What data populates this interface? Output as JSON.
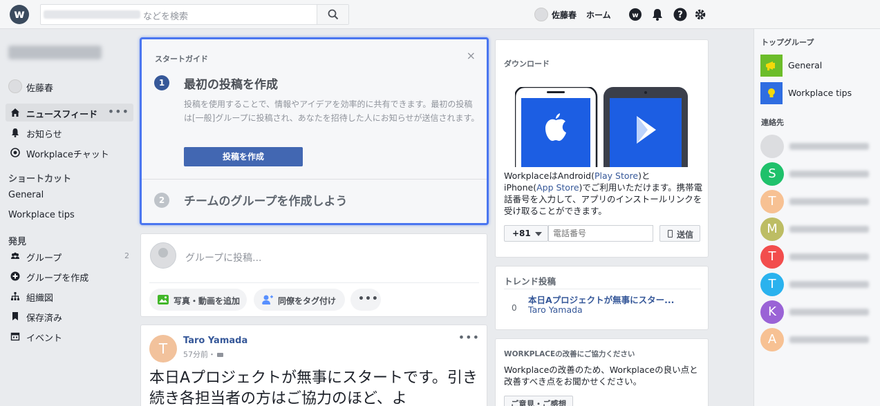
{
  "search": {
    "placeholder": "Delighted Inc.のグループなどを検索",
    "visible_suffix": "などを検索"
  },
  "topbar": {
    "logo_letter": "w",
    "user_name": "佐藤春",
    "home_label": "ホーム"
  },
  "leftnav": {
    "user_name": "佐藤春",
    "items": [
      {
        "label": "ニュースフィード",
        "more": "•••"
      },
      {
        "label": "お知らせ"
      },
      {
        "label": "Workplaceチャット"
      }
    ],
    "shortcuts_heading": "ショートカット",
    "shortcuts": [
      "General",
      "Workplace tips"
    ],
    "discover_heading": "発見",
    "discover": [
      {
        "label": "グループ",
        "count": "2"
      },
      {
        "label": "グループを作成"
      },
      {
        "label": "組織図"
      },
      {
        "label": "保存済み"
      },
      {
        "label": "イベント"
      }
    ]
  },
  "guide": {
    "title": "スタートガイド",
    "close": "×",
    "step1": {
      "num": "1",
      "title": "最初の投稿を作成",
      "desc": "投稿を使用することで、情報やアイデアを効率的に共有できます。最初の投稿は[一般]グループに投稿され、あなたを招待した人にお知らせが送信されます。",
      "button": "投稿を作成"
    },
    "step2": {
      "num": "2",
      "title": "チームのグループを作成しよう"
    }
  },
  "composer": {
    "placeholder": "グループに投稿...",
    "actions": [
      {
        "label": "写真・動画を追加",
        "color": "#42b72a"
      },
      {
        "label": "同僚をタグ付け",
        "color": "#5890ff"
      },
      {
        "label": "•••"
      }
    ]
  },
  "post": {
    "avatar_letter": "T",
    "author": "Taro Yamada",
    "time": "57分前・",
    "dots": "•••",
    "body": "本日Aプロジェクトが無事にスタートです。引き続き各担当者の方はご協力のほど、よ"
  },
  "download": {
    "title": "ダウンロード",
    "text_1": "WorkplaceはAndroid(",
    "play_store": "Play Store",
    "text_2": ")と",
    "text_3": "iPhone(",
    "app_store": "App Store",
    "text_4": ")でご利用いただけます。携帯電話番号を入力して、アプリのインストールリンクを受け取ることができます。",
    "country_code": "+81",
    "phone_placeholder": "電話番号",
    "send": "送信"
  },
  "trend": {
    "title": "トレンド投稿",
    "count": "0",
    "post_title": "本日Aプロジェクトが無事にスター...",
    "post_author": "Taro Yamada"
  },
  "feedback": {
    "title": "WORKPLACEの改善にご協力ください",
    "text": "Workplaceの改善のため、Workplaceの良い点と改善すべき点をお聞かせください。",
    "button": "ご意見・ご感想"
  },
  "rightbar": {
    "top_groups_heading": "トップグループ",
    "groups": [
      {
        "label": "General",
        "color": "#6cbd2a"
      },
      {
        "label": "Workplace tips",
        "color": "#2f6de1"
      }
    ],
    "contacts_heading": "連絡先",
    "contacts": [
      {
        "letter": "",
        "color": "#dcdde0"
      },
      {
        "letter": "S",
        "color": "#1fc16b"
      },
      {
        "letter": "T",
        "color": "#f7c193"
      },
      {
        "letter": "M",
        "color": "#bdbd64"
      },
      {
        "letter": "T",
        "color": "#f24d4d"
      },
      {
        "letter": "T",
        "color": "#2ab2ee"
      },
      {
        "letter": "K",
        "color": "#9a63d6"
      },
      {
        "letter": "A",
        "color": "#f7c193"
      }
    ]
  },
  "colors": {
    "accent": "#4267b2",
    "link": "#365899",
    "focus": "#4a76f0"
  }
}
